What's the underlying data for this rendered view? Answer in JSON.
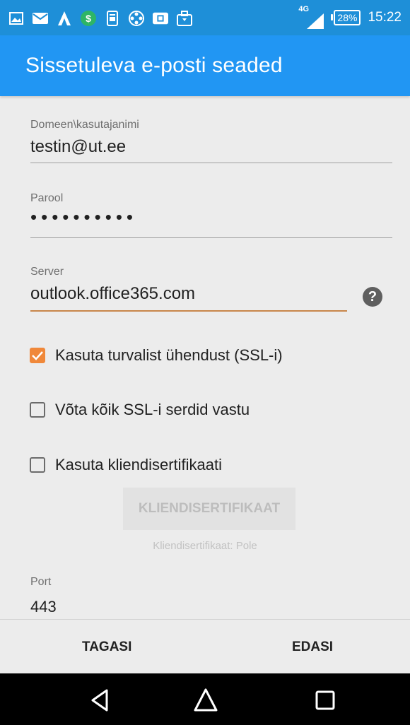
{
  "status_bar": {
    "notification_icons": [
      "image-icon",
      "mail-icon",
      "arch-icon",
      "money-icon",
      "document-icon",
      "film-reel-icon",
      "cc-icon",
      "briefcase-icon"
    ],
    "network": "4G",
    "battery": "28%",
    "time": "15:22"
  },
  "appbar": {
    "title": "Sissetuleva e-posti seaded"
  },
  "form": {
    "username": {
      "label": "Domeen\\kasutajanimi",
      "value": "testin@ut.ee"
    },
    "password": {
      "label": "Parool",
      "value": "••••••••••"
    },
    "server": {
      "label": "Server",
      "value": "outlook.office365.com"
    },
    "checkboxes": [
      {
        "label": "Kasuta turvalist ühendust (SSL-i)",
        "checked": true
      },
      {
        "label": "Võta kõik SSL-i serdid vastu",
        "checked": false
      },
      {
        "label": "Kasuta kliendisertifikaati",
        "checked": false
      }
    ],
    "client_cert_button": "KLIENDISERTIFIKAAT",
    "client_cert_status": "Kliendisertifikaat: Pole",
    "port": {
      "label": "Port",
      "value": "443"
    }
  },
  "footer": {
    "back": "TAGASI",
    "next": "EDASI"
  },
  "colors": {
    "status_bar": "#1e8fd8",
    "app_bar": "#2196f3",
    "accent": "#f0883a",
    "background": "#ececec"
  }
}
